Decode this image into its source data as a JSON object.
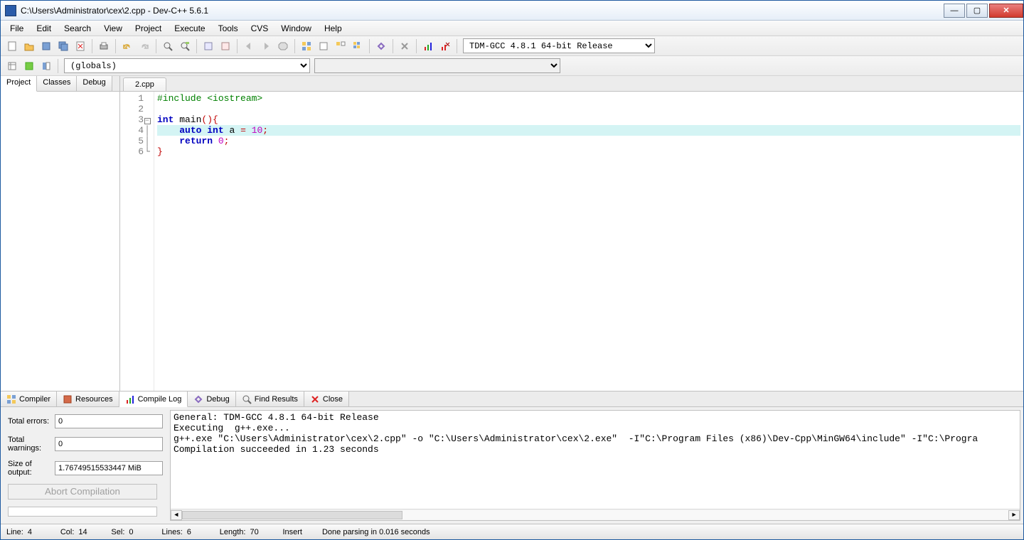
{
  "title": "C:\\Users\\Administrator\\cex\\2.cpp - Dev-C++ 5.6.1",
  "menus": [
    "File",
    "Edit",
    "Search",
    "View",
    "Project",
    "Execute",
    "Tools",
    "CVS",
    "Window",
    "Help"
  ],
  "compiler_profile": "TDM-GCC 4.8.1 64-bit Release",
  "globals_select": "(globals)",
  "left_tabs": [
    "Project",
    "Classes",
    "Debug"
  ],
  "file_tab": "2.cpp",
  "code": {
    "lines": [
      {
        "n": 1,
        "html": "<span class='c-green'>#include &lt;iostream&gt;</span>"
      },
      {
        "n": 2,
        "html": ""
      },
      {
        "n": 3,
        "html": "<span class='c-blue'>int</span> main<span class='c-red'>(){</span>",
        "fold": true
      },
      {
        "n": 4,
        "html": "    <span class='c-blue'>auto</span> <span class='c-blue'>int</span> a <span class='c-red'>=</span> <span class='c-pink'>10</span><span class='c-red'>;</span>",
        "hl": true
      },
      {
        "n": 5,
        "html": "    <span class='c-blue'>return</span> <span class='c-pink'>0</span><span class='c-red'>;</span>"
      },
      {
        "n": 6,
        "html": "<span class='c-red'>}</span>"
      }
    ]
  },
  "bottom_tabs": [
    {
      "label": "Compiler",
      "active": false
    },
    {
      "label": "Resources",
      "active": false
    },
    {
      "label": "Compile Log",
      "active": true
    },
    {
      "label": "Debug",
      "active": false
    },
    {
      "label": "Find Results",
      "active": false
    },
    {
      "label": "Close",
      "active": false
    }
  ],
  "compile_stats": {
    "errors_label": "Total errors:",
    "errors": "0",
    "warnings_label": "Total warnings:",
    "warnings": "0",
    "size_label": "Size of output:",
    "size": "1.76749515533447 MiB",
    "abort": "Abort Compilation"
  },
  "log_lines": [
    "General: TDM-GCC 4.8.1 64-bit Release",
    "Executing  g++.exe...",
    "g++.exe \"C:\\Users\\Administrator\\cex\\2.cpp\" -o \"C:\\Users\\Administrator\\cex\\2.exe\"  -I\"C:\\Program Files (x86)\\Dev-Cpp\\MinGW64\\include\" -I\"C:\\Progra",
    "Compilation succeeded in 1.23 seconds"
  ],
  "status": {
    "line_lbl": "Line:",
    "line": "4",
    "col_lbl": "Col:",
    "col": "14",
    "sel_lbl": "Sel:",
    "sel": "0",
    "lines_lbl": "Lines:",
    "lines": "6",
    "len_lbl": "Length:",
    "len": "70",
    "mode": "Insert",
    "msg": "Done parsing in 0.016 seconds"
  }
}
